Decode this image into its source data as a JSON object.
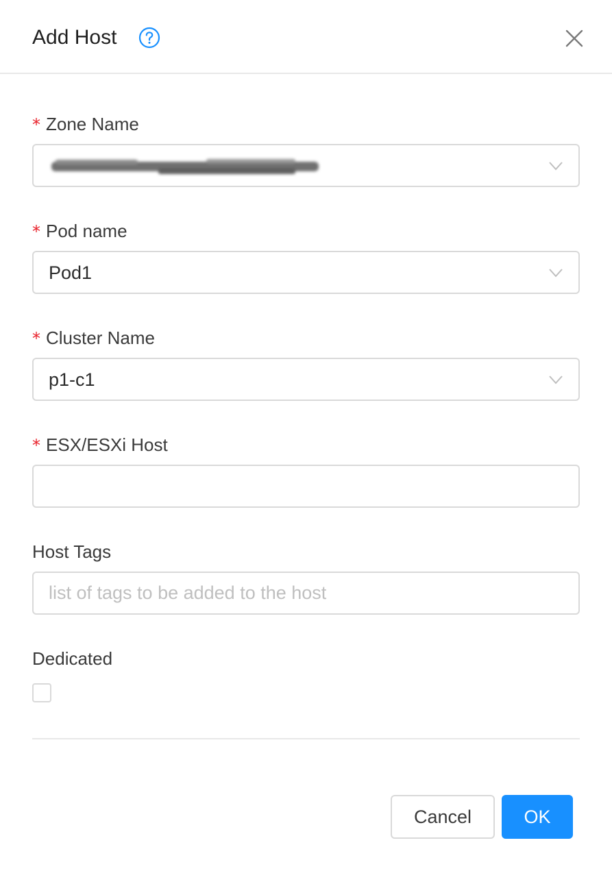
{
  "dialog": {
    "title": "Add Host",
    "close_icon": "close-icon",
    "help_icon": "question-circle-icon"
  },
  "form": {
    "zone": {
      "label": "Zone Name",
      "required": true,
      "value": "",
      "value_redacted": true
    },
    "pod": {
      "label": "Pod name",
      "required": true,
      "value": "Pod1"
    },
    "cluster": {
      "label": "Cluster Name",
      "required": true,
      "value": "p1-c1"
    },
    "esx_host": {
      "label": "ESX/ESXi Host",
      "required": true,
      "value": "",
      "placeholder": ""
    },
    "host_tags": {
      "label": "Host Tags",
      "required": false,
      "value": "",
      "placeholder": "list of tags to be added to the host"
    },
    "dedicated": {
      "label": "Dedicated",
      "checked": false
    },
    "required_marker": "*"
  },
  "footer": {
    "cancel_label": "Cancel",
    "ok_label": "OK"
  },
  "colors": {
    "primary": "#1890ff",
    "required": "#e8202a",
    "border": "#d9d9d9",
    "placeholder": "#bfbfbf"
  }
}
